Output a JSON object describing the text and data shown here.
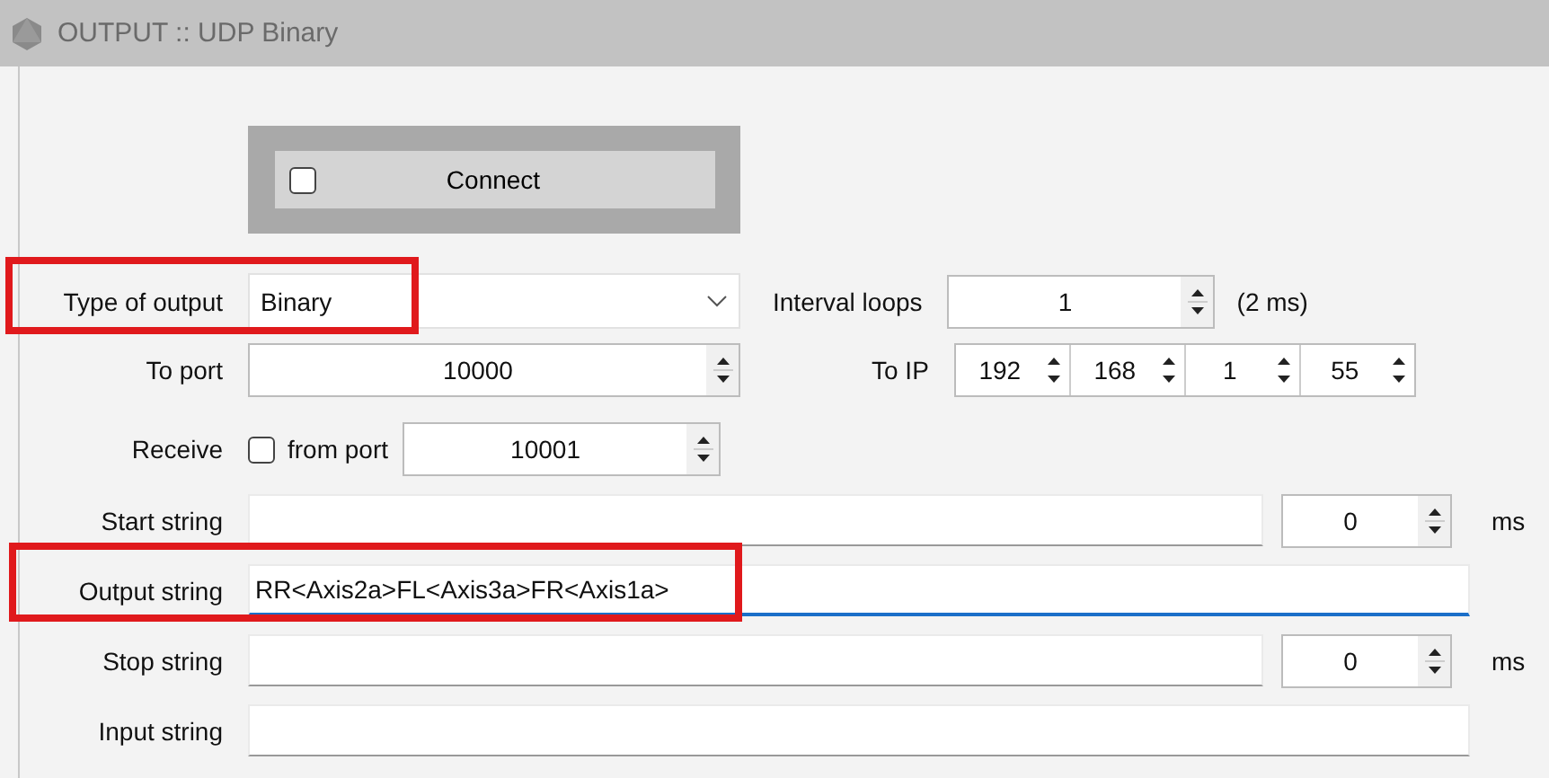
{
  "window": {
    "title": "OUTPUT :: UDP Binary"
  },
  "connect": {
    "label": "Connect",
    "checked": false
  },
  "type_of_output": {
    "label": "Type of output",
    "value": "Binary",
    "highlighted": true
  },
  "interval_loops": {
    "label": "Interval loops",
    "value": "1",
    "note": "(2 ms)"
  },
  "to_port": {
    "label": "To port",
    "value": "10000"
  },
  "to_ip": {
    "label": "To IP",
    "octets": [
      "192",
      "168",
      "1",
      "55"
    ]
  },
  "receive": {
    "label": "Receive",
    "checked": false,
    "from_port_label": "from port",
    "value": "10001"
  },
  "strings": [
    {
      "label": "Start string",
      "focused": false,
      "highlighted": false,
      "delay": "0",
      "unit": "ms"
    },
    {
      "label": "Output string",
      "value": "RR<Axis2a>FL<Axis3a>FR<Axis1a>",
      "focused": true,
      "highlighted": true
    },
    {
      "label": "Stop string",
      "focused": false,
      "highlighted": false,
      "delay": "0",
      "unit": "ms"
    },
    {
      "label": "Input string",
      "focused": false,
      "highlighted": false
    }
  ]
}
